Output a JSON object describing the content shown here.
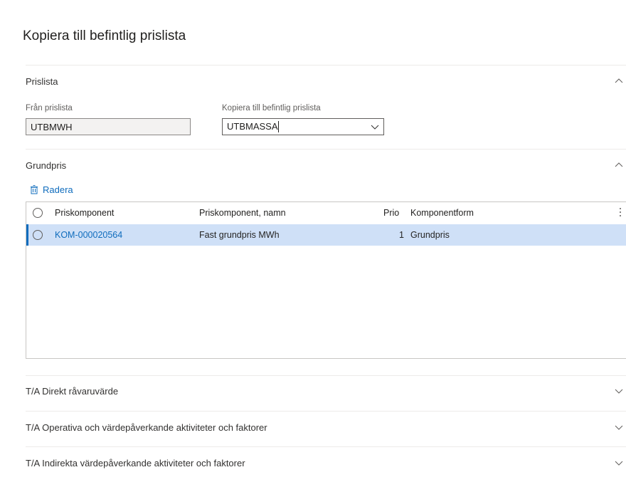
{
  "page": {
    "title": "Kopiera till befintlig prislista"
  },
  "prislista": {
    "section_label": "Prislista",
    "from_label": "Från prislista",
    "from_value": "UTBMWH",
    "to_label": "Kopiera till befintlig prislista",
    "to_value": "UTBMASSA"
  },
  "grundpris": {
    "section_label": "Grundpris",
    "delete_label": "Radera",
    "columns": [
      "Priskomponent",
      "Priskomponent, namn",
      "Prio",
      "Komponentform"
    ],
    "rows": [
      {
        "priskomponent": "KOM-000020564",
        "namn": "Fast grundpris MWh",
        "prio": "1",
        "komponentform": "Grundpris"
      }
    ]
  },
  "collapsed_sections": [
    {
      "label": "T/A Direkt råvaruvärde"
    },
    {
      "label": "T/A Operativa och värdepåverkande aktiviteter och faktorer"
    },
    {
      "label": "T/A Indirekta värdepåverkande aktiviteter och faktorer"
    }
  ],
  "icons": {
    "chevron_up": "chevron-up-icon",
    "chevron_down": "chevron-down-icon",
    "delete": "trash-icon",
    "more": "more-vertical-icon"
  },
  "colors": {
    "accent": "#0f6cbd",
    "selected_row": "#cfe0f7",
    "readonly_field": "#f3f2f1"
  }
}
